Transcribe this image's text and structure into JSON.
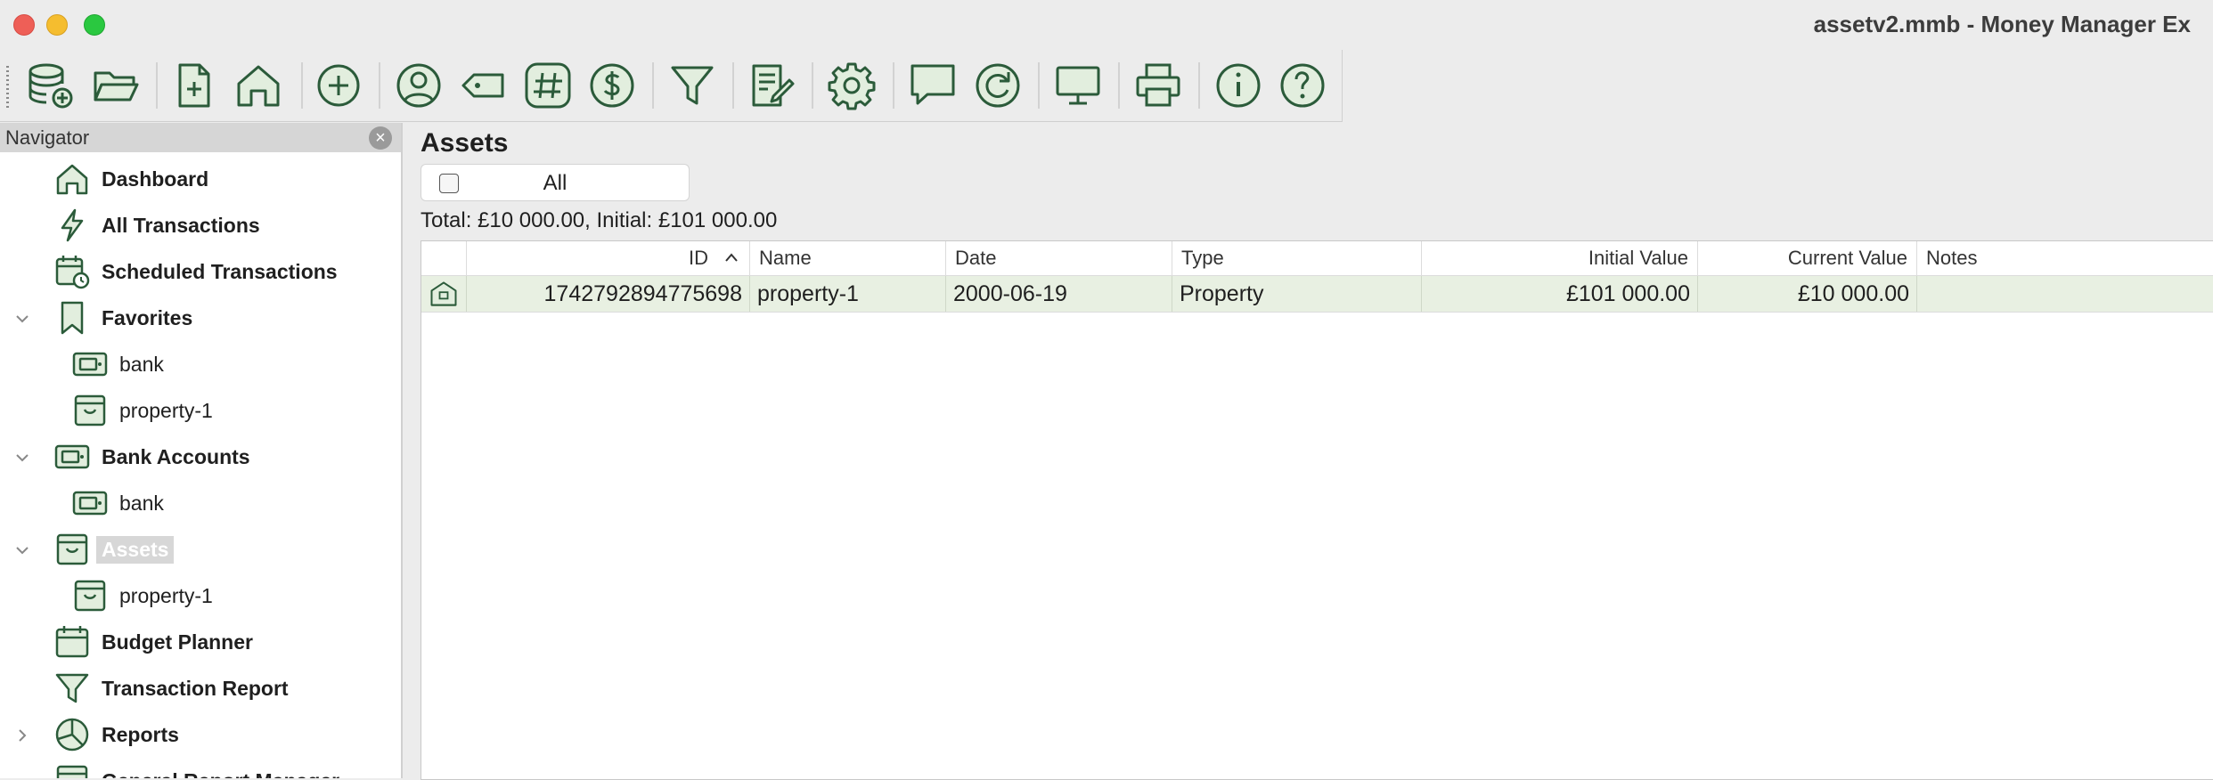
{
  "window": {
    "title": "assetv2.mmb - Money Manager Ex"
  },
  "toolbar": {
    "buttons": [
      {
        "icon": "new-database-icon"
      },
      {
        "icon": "open-folder-icon"
      },
      {
        "icon": "new-document-icon"
      },
      {
        "icon": "home-icon"
      },
      {
        "icon": "add-transaction-icon"
      },
      {
        "icon": "payee-icon"
      },
      {
        "icon": "tag-icon"
      },
      {
        "icon": "category-hash-icon"
      },
      {
        "icon": "currency-icon"
      },
      {
        "icon": "filter-icon"
      },
      {
        "icon": "edit-note-icon"
      },
      {
        "icon": "settings-gear-icon"
      },
      {
        "icon": "feedback-icon"
      },
      {
        "icon": "refresh-icon"
      },
      {
        "icon": "monitor-icon"
      },
      {
        "icon": "print-icon"
      },
      {
        "icon": "info-icon"
      },
      {
        "icon": "help-icon"
      }
    ]
  },
  "navigator": {
    "header": "Navigator",
    "items": [
      {
        "label": "Dashboard",
        "icon": "home-icon"
      },
      {
        "label": "All Transactions",
        "icon": "lightning-icon"
      },
      {
        "label": "Scheduled Transactions",
        "icon": "calendar-clock-icon"
      },
      {
        "label": "Favorites",
        "icon": "bookmark-icon"
      },
      {
        "label": "bank",
        "icon": "bank-account-icon"
      },
      {
        "label": "property-1",
        "icon": "asset-box-icon"
      },
      {
        "label": "Bank Accounts",
        "icon": "bank-account-icon"
      },
      {
        "label": "bank",
        "icon": "bank-account-icon"
      },
      {
        "label": "Assets",
        "icon": "asset-box-icon"
      },
      {
        "label": "property-1",
        "icon": "asset-box-icon"
      },
      {
        "label": "Budget Planner",
        "icon": "calendar-icon"
      },
      {
        "label": "Transaction Report",
        "icon": "filter-icon"
      },
      {
        "label": "Reports",
        "icon": "pie-chart-icon"
      },
      {
        "label": "General Report Manager",
        "icon": "report-icon"
      }
    ]
  },
  "main": {
    "title": "Assets",
    "filter_label": "All",
    "totals": "Total: £10 000.00, Initial: £101 000.00",
    "columns": [
      "ID",
      "Name",
      "Date",
      "Type",
      "Initial Value",
      "Current Value",
      "Notes"
    ],
    "rows": [
      {
        "id": "1742792894775698",
        "name": "property-1",
        "date": "2000-06-19",
        "type": "Property",
        "initial": "£101 000.00",
        "current": "£10 000.00",
        "notes": ""
      }
    ]
  },
  "colors": {
    "icon_green": "#2b5b3a",
    "icon_fill": "#e2eede",
    "row_bg": "#e8f0e2"
  }
}
